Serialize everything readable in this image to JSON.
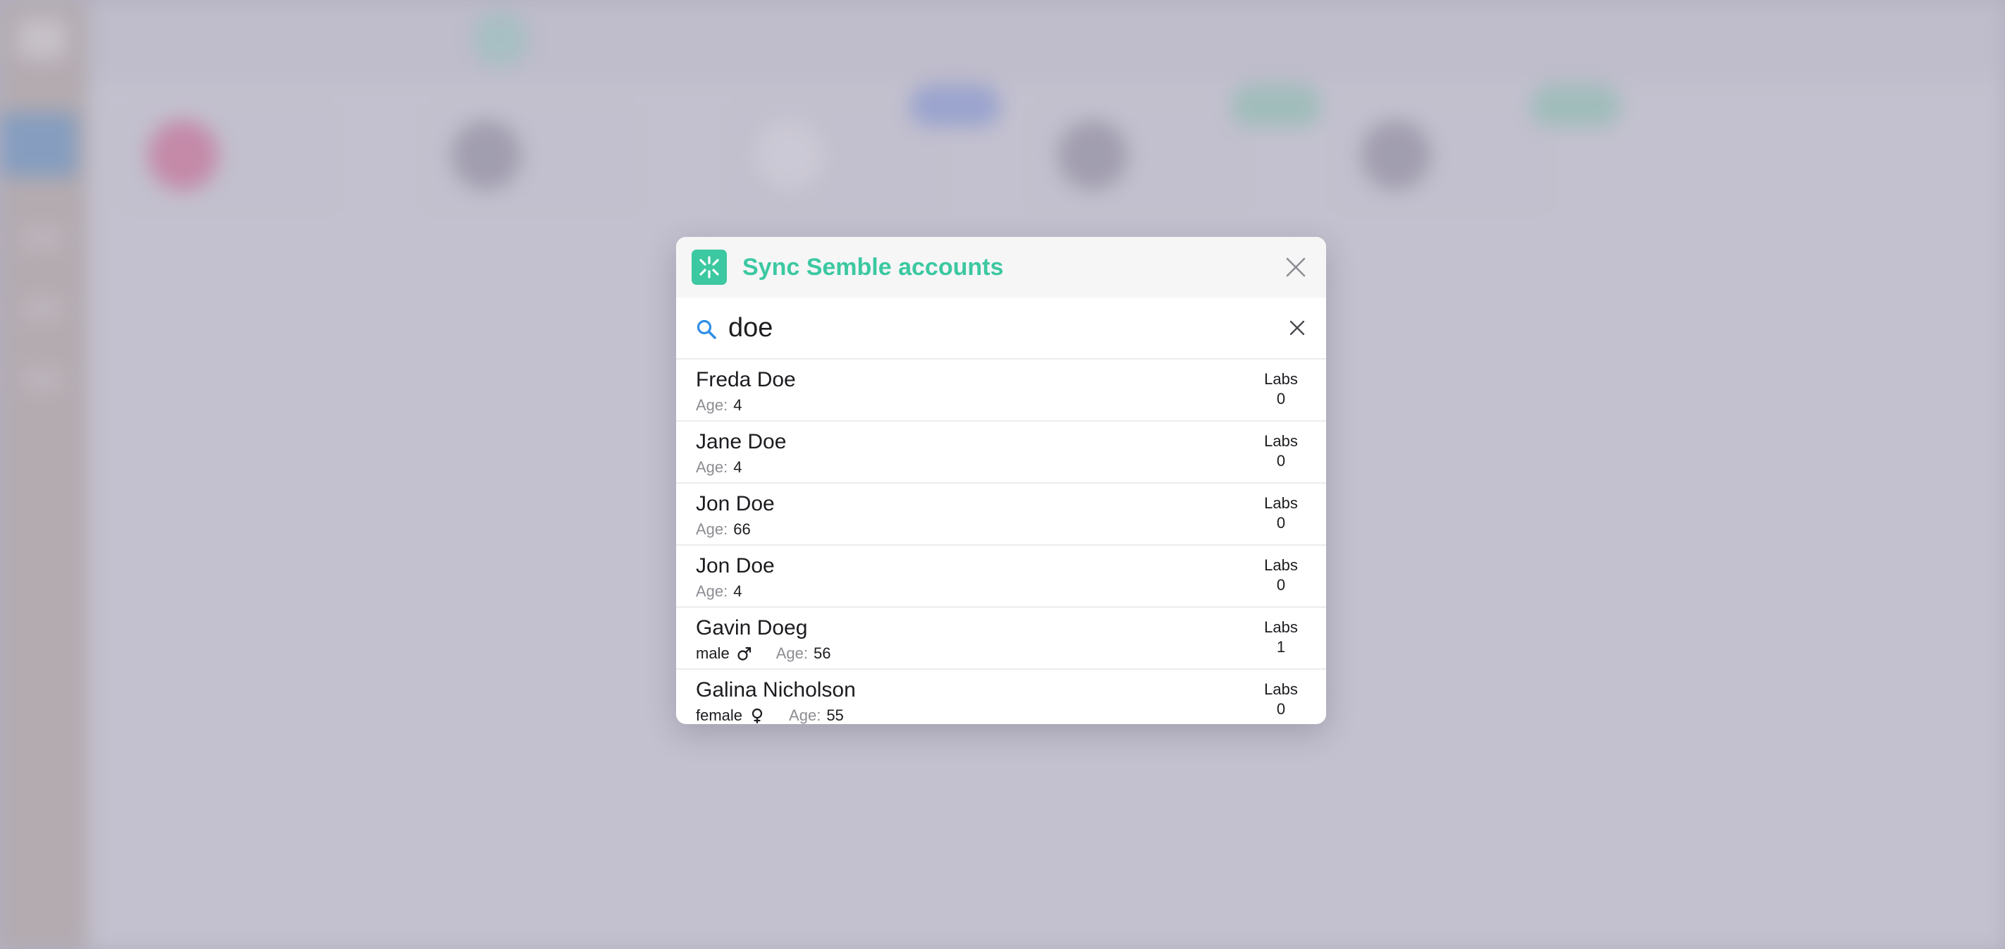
{
  "modal": {
    "title": "Sync Semble accounts",
    "brand_icon": "semble-logo-icon",
    "close_icon": "close-icon",
    "accent_color": "#3cc8a1"
  },
  "search": {
    "value": "doe",
    "icon": "search-icon",
    "clear_icon": "clear-icon"
  },
  "labels": {
    "age": "Age:",
    "labs": "Labs"
  },
  "results": [
    {
      "name": "Freda Doe",
      "gender": "",
      "age": "4",
      "labs": "0"
    },
    {
      "name": "Jane Doe",
      "gender": "",
      "age": "4",
      "labs": "0"
    },
    {
      "name": "Jon Doe",
      "gender": "",
      "age": "66",
      "labs": "0"
    },
    {
      "name": "Jon Doe",
      "gender": "",
      "age": "4",
      "labs": "0"
    },
    {
      "name": "Gavin Doeg",
      "gender": "male",
      "age": "56",
      "labs": "1"
    },
    {
      "name": "Galina Nicholson",
      "gender": "female",
      "age": "55",
      "labs": "0"
    }
  ]
}
